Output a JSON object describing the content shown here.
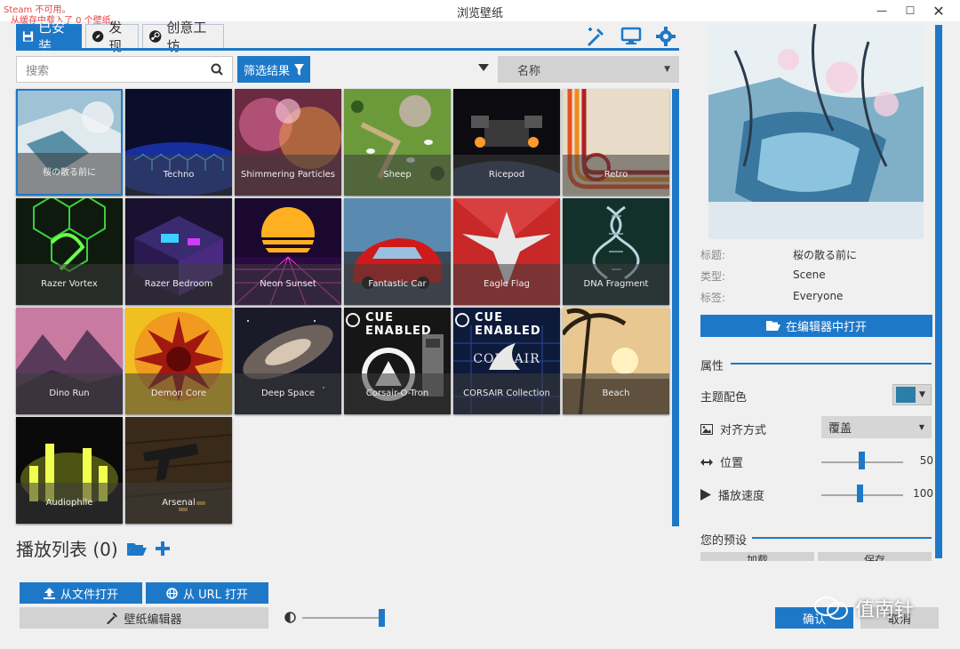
{
  "window": {
    "title": "浏览壁纸"
  },
  "status": {
    "line1": "Steam 不可用。",
    "line2": "从缓存中载入了 0 个壁纸。"
  },
  "tabs": [
    {
      "label": "已安装",
      "icon": "save-icon"
    },
    {
      "label": "发现",
      "icon": "compass-icon"
    },
    {
      "label": "创意工坊",
      "icon": "steam-icon"
    }
  ],
  "search": {
    "placeholder": "搜索"
  },
  "filter": {
    "label": "筛选结果"
  },
  "sort": {
    "value": "名称"
  },
  "wallpapers": [
    {
      "name": "桜の散る前に",
      "selected": true
    },
    {
      "name": "Techno"
    },
    {
      "name": "Shimmering Particles"
    },
    {
      "name": "Sheep"
    },
    {
      "name": "Ricepod"
    },
    {
      "name": "Retro"
    },
    {
      "name": "Razer Vortex"
    },
    {
      "name": "Razer Bedroom"
    },
    {
      "name": "Neon Sunset"
    },
    {
      "name": "Fantastic Car"
    },
    {
      "name": "Eagle Flag"
    },
    {
      "name": "DNA Fragment"
    },
    {
      "name": "Dino Run"
    },
    {
      "name": "Demon Core"
    },
    {
      "name": "Deep Space"
    },
    {
      "name": "Corsair-O-Tron"
    },
    {
      "name": "CORSAIR Collection"
    },
    {
      "name": "Beach"
    },
    {
      "name": "Audiophile"
    },
    {
      "name": "Arsenal"
    }
  ],
  "badges": {
    "cue_enabled": "CUE ENABLED",
    "corsair_logo": "CORSAIR"
  },
  "playlist": {
    "label": "播放列表 (0)"
  },
  "buttons": {
    "open_file": "从文件打开",
    "open_url": "从 URL 打开",
    "editor": "壁纸编辑器",
    "open_in_editor": "在编辑器中打开",
    "load": "加载",
    "save": "保存",
    "ok": "确认",
    "cancel": "取消"
  },
  "details": {
    "title_label": "标题:",
    "title_value": "桜の散る前に",
    "type_label": "类型:",
    "type_value": "Scene",
    "tags_label": "标签:",
    "tags_value": "Everyone"
  },
  "properties": {
    "heading": "属性",
    "scheme_label": "主题配色",
    "scheme_color": "#2a7fa8",
    "align_label": "对齐方式",
    "align_value": "覆盖",
    "position_label": "位置",
    "position_value": "50",
    "speed_label": "播放速度",
    "speed_value": "100"
  },
  "presets": {
    "heading": "您的预设"
  },
  "watermark": {
    "text": "值南针"
  },
  "accent": "#1e78c8"
}
